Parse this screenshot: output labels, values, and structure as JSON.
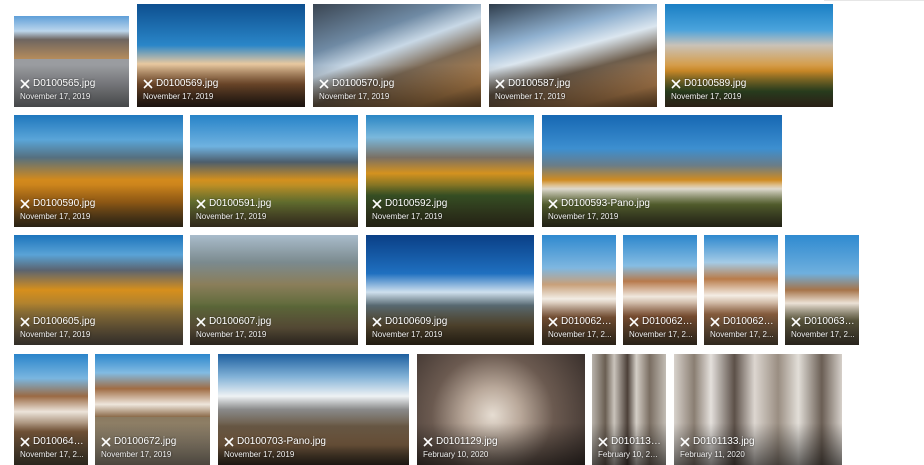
{
  "gallery": {
    "items": [
      {
        "filename": "D0100565.jpg",
        "date": "November 17, 2019"
      },
      {
        "filename": "D0100569.jpg",
        "date": "November 17, 2019"
      },
      {
        "filename": "D0100570.jpg",
        "date": "November 17, 2019"
      },
      {
        "filename": "D0100587.jpg",
        "date": "November 17, 2019"
      },
      {
        "filename": "D0100589.jpg",
        "date": "November 17, 2019"
      },
      {
        "filename": "D0100590.jpg",
        "date": "November 17, 2019"
      },
      {
        "filename": "D0100591.jpg",
        "date": "November 17, 2019"
      },
      {
        "filename": "D0100592.jpg",
        "date": "November 17, 2019"
      },
      {
        "filename": "D0100593-Pano.jpg",
        "date": "November 17, 2019"
      },
      {
        "filename": "D0100605.jpg",
        "date": "November 17, 2019"
      },
      {
        "filename": "D0100607.jpg",
        "date": "November 17, 2019"
      },
      {
        "filename": "D0100609.jpg",
        "date": "November 17, 2019"
      },
      {
        "filename": "D0100623....",
        "date": "November 17, 2..."
      },
      {
        "filename": "D0100624....",
        "date": "November 17, 2..."
      },
      {
        "filename": "D0100627....",
        "date": "November 17, 2..."
      },
      {
        "filename": "D0100632....",
        "date": "November 17, 2..."
      },
      {
        "filename": "D0100643....",
        "date": "November 17, 2..."
      },
      {
        "filename": "D0100672.jpg",
        "date": "November 17, 2019"
      },
      {
        "filename": "D0100703-Pano.jpg",
        "date": "November 17, 2019"
      },
      {
        "filename": "D0101129.jpg",
        "date": "February 10, 2020"
      },
      {
        "filename": "D0101132....",
        "date": "February 10, 2020"
      },
      {
        "filename": "D0101133.jpg",
        "date": "February 11, 2020"
      }
    ]
  },
  "icons": {
    "edit": "crossed-tools-icon"
  },
  "colors": {
    "sky": "#1b6fb6",
    "autumn": "#d48a1a",
    "mountain": "#6b5a4c",
    "frost": "#d8d4ce"
  }
}
